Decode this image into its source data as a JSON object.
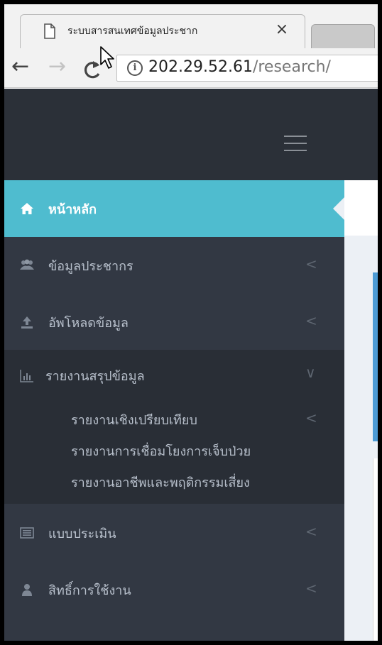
{
  "browser": {
    "tab_title": "ระบบสารสนเทศข้อมูลประชาก",
    "tab_close": "×",
    "url_host": "202.29.52.61",
    "url_path": "/research/",
    "info_glyph": "i",
    "back_glyph": "←",
    "forward_glyph": "→",
    "reload_glyph": "C"
  },
  "sidebar": {
    "items": [
      {
        "label": "หน้าหลัก",
        "icon": "home-icon",
        "state": "active"
      },
      {
        "label": "ข้อมูลประชากร",
        "icon": "users-icon",
        "arrow": "<"
      },
      {
        "label": "อัพโหลดข้อมูล",
        "icon": "upload-icon",
        "arrow": "<"
      },
      {
        "label": "รายงานสรุปข้อมูล",
        "icon": "bar-chart-icon",
        "arrow": "∨",
        "state": "open"
      },
      {
        "label": "แบบประเมิน",
        "icon": "list-icon",
        "arrow": "<"
      },
      {
        "label": "สิทธิ์การใช้งาน",
        "icon": "user-icon",
        "arrow": "<"
      }
    ],
    "submenu": [
      {
        "label": "รายงานเชิงเปรียบเทียบ",
        "arrow": "<"
      },
      {
        "label": "รายงานการเชื่อมโยงการเจ็บป่วย"
      },
      {
        "label": "รายงานอาชีพและพฤติกรรมเสี่ยง"
      }
    ]
  },
  "colors": {
    "header_bg": "#2b3038",
    "sidebar_bg": "#323843",
    "active_bg": "#4fbccf",
    "content_accent": "#4d9bd5"
  }
}
